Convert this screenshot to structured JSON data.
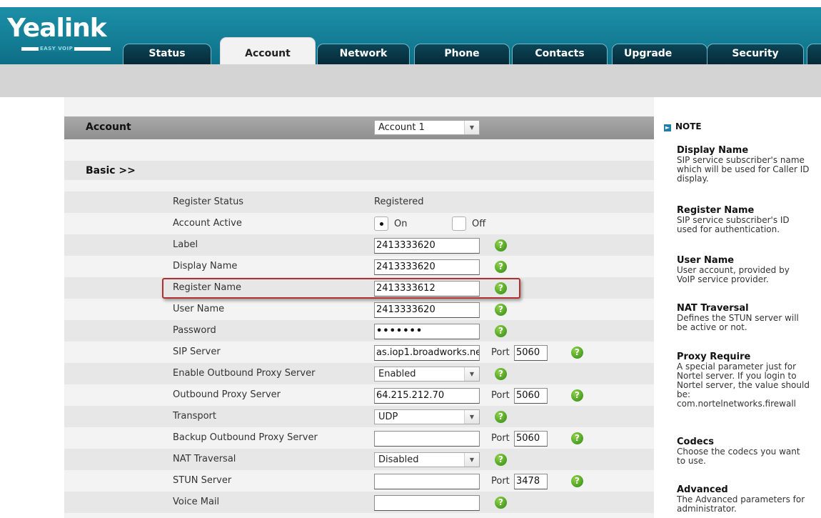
{
  "brand": {
    "name": "Yealink",
    "tagline": "EASY VOIP"
  },
  "nav": {
    "tabs": [
      {
        "label": "Status",
        "active": false
      },
      {
        "label": "Account",
        "active": true
      },
      {
        "label": "Network",
        "active": false
      },
      {
        "label": "Phone",
        "active": false
      },
      {
        "label": "Contacts",
        "active": false
      },
      {
        "label": "Upgrade",
        "active": false
      },
      {
        "label": "Security",
        "active": false
      }
    ]
  },
  "account": {
    "label": "Account",
    "selected": "Account 1"
  },
  "section": {
    "label": "Basic >>"
  },
  "fields": {
    "register_status": {
      "label": "Register Status",
      "value": "Registered"
    },
    "account_active": {
      "label": "Account Active",
      "on": "On",
      "off": "Off",
      "selected": "On"
    },
    "label": {
      "label": "Label",
      "value": "2413333620"
    },
    "display_name": {
      "label": "Display Name",
      "value": "2413333620"
    },
    "register_name": {
      "label": "Register Name",
      "value": "2413333612"
    },
    "user_name": {
      "label": "User Name",
      "value": "2413333620"
    },
    "password": {
      "label": "Password",
      "value": "•••••••"
    },
    "sip_server": {
      "label": "SIP Server",
      "value": "as.iop1.broadworks.ne",
      "port_label": "Port",
      "port": "5060"
    },
    "enable_outbound": {
      "label": "Enable Outbound Proxy Server",
      "value": "Enabled"
    },
    "outbound_proxy": {
      "label": "Outbound Proxy Server",
      "value": "64.215.212.70",
      "port_label": "Port",
      "port": "5060"
    },
    "transport": {
      "label": "Transport",
      "value": "UDP"
    },
    "backup_outbound": {
      "label": "Backup Outbound Proxy Server",
      "value": "",
      "port_label": "Port",
      "port": "5060"
    },
    "nat_traversal": {
      "label": "NAT Traversal",
      "value": "Disabled"
    },
    "stun_server": {
      "label": "STUN Server",
      "value": "",
      "port_label": "Port",
      "port": "3478"
    },
    "voice_mail": {
      "label": "Voice Mail",
      "value": ""
    }
  },
  "help_glyph": "?",
  "note": {
    "heading": "NOTE",
    "icon": "note-arrow-icon",
    "items": [
      {
        "title": "Display Name",
        "lines": [
          "SIP service subscriber's name",
          "which will be used for Caller ID",
          "display."
        ]
      },
      {
        "title": "Register Name",
        "lines": [
          "SIP service subscriber's ID",
          "used for authentication."
        ]
      },
      {
        "title": "User Name",
        "lines": [
          "User account, provided by",
          "VoIP service provider."
        ]
      },
      {
        "title": "NAT Traversal",
        "lines": [
          "Defines the STUN server will",
          "be active or not."
        ]
      },
      {
        "title": "Proxy Require",
        "lines": [
          "A special parameter just for",
          "Nortel server. If you login to",
          "Nortel server, the value should",
          "be:",
          "com.nortelnetworks.firewall"
        ]
      },
      {
        "title": "Codecs",
        "lines": [
          "Choose the codecs you want",
          "to use."
        ]
      },
      {
        "title": "Advanced",
        "lines": [
          "The Advanced parameters for",
          "administrator."
        ]
      }
    ]
  },
  "colors": {
    "header": "#147f97",
    "help": "#3d9a1a",
    "highlight": "#b03030"
  }
}
